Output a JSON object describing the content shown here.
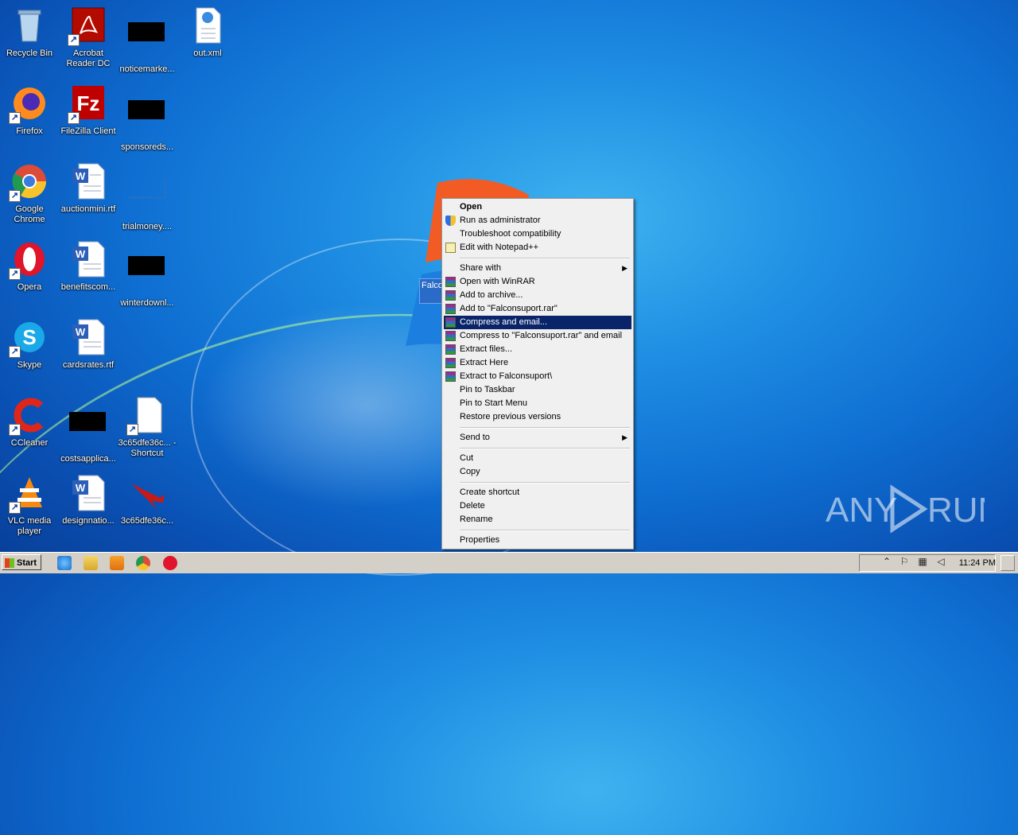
{
  "desktop": {
    "icons": [
      {
        "label": "Recycle Bin"
      },
      {
        "label": "Acrobat Reader DC"
      },
      {
        "label": "noticemarke..."
      },
      {
        "label": "out.xml"
      },
      {
        "label": "Firefox"
      },
      {
        "label": "FileZilla Client"
      },
      {
        "label": "sponsoreds..."
      },
      {
        "label": "Google Chrome"
      },
      {
        "label": "auctionmini.rtf"
      },
      {
        "label": "trialmoney...."
      },
      {
        "label": "Opera"
      },
      {
        "label": "benefitscom..."
      },
      {
        "label": "winterdownl..."
      },
      {
        "label": "Skype"
      },
      {
        "label": "cardsrates.rtf"
      },
      {
        "label": "CCleaner"
      },
      {
        "label": "costsapplica..."
      },
      {
        "label": "3c65dfe36c... - Shortcut"
      },
      {
        "label": "VLC media player"
      },
      {
        "label": "designnatio..."
      },
      {
        "label": "3c65dfe36c..."
      }
    ],
    "selected_label": "Falcon"
  },
  "context_menu": {
    "items": [
      {
        "label": "Open",
        "bold": true
      },
      {
        "label": "Run as administrator",
        "icon": "uac-shield-icon"
      },
      {
        "label": "Troubleshoot compatibility"
      },
      {
        "label": "Edit with Notepad++",
        "icon": "notepad-plus-plus-icon"
      },
      {
        "label": "Share with",
        "submenu": true
      },
      {
        "label": "Open with WinRAR",
        "icon": "winrar-icon"
      },
      {
        "label": "Add to archive...",
        "icon": "winrar-icon"
      },
      {
        "label": "Add to \"Falconsuport.rar\"",
        "icon": "winrar-icon"
      },
      {
        "label": "Compress and email...",
        "icon": "winrar-icon",
        "highlighted": true
      },
      {
        "label": "Compress to \"Falconsuport.rar\" and email",
        "icon": "winrar-icon"
      },
      {
        "label": "Extract files...",
        "icon": "winrar-icon"
      },
      {
        "label": "Extract Here",
        "icon": "winrar-icon"
      },
      {
        "label": "Extract to Falconsuport\\",
        "icon": "winrar-icon"
      },
      {
        "label": "Pin to Taskbar"
      },
      {
        "label": "Pin to Start Menu"
      },
      {
        "label": "Restore previous versions"
      },
      {
        "label": "Send to",
        "submenu": true
      },
      {
        "label": "Cut"
      },
      {
        "label": "Copy"
      },
      {
        "label": "Create shortcut"
      },
      {
        "label": "Delete"
      },
      {
        "label": "Rename"
      },
      {
        "label": "Properties"
      }
    ],
    "submenu_arrow": "▶"
  },
  "taskbar": {
    "start_label": "Start",
    "pinned": [
      "internet-explorer-icon",
      "explorer-icon",
      "media-player-icon",
      "chrome-icon",
      "opera-icon"
    ],
    "clock": "11:24 PM",
    "tray_icons": [
      "show-hidden-icons-icon",
      "action-center-flag-icon",
      "network-icon",
      "volume-icon"
    ]
  },
  "watermark": {
    "text": "ANY RUN"
  },
  "colors": {
    "highlight": "#0a246a",
    "menu_bg": "#f0f0f0",
    "taskbar_bg": "#d4d0c8"
  }
}
